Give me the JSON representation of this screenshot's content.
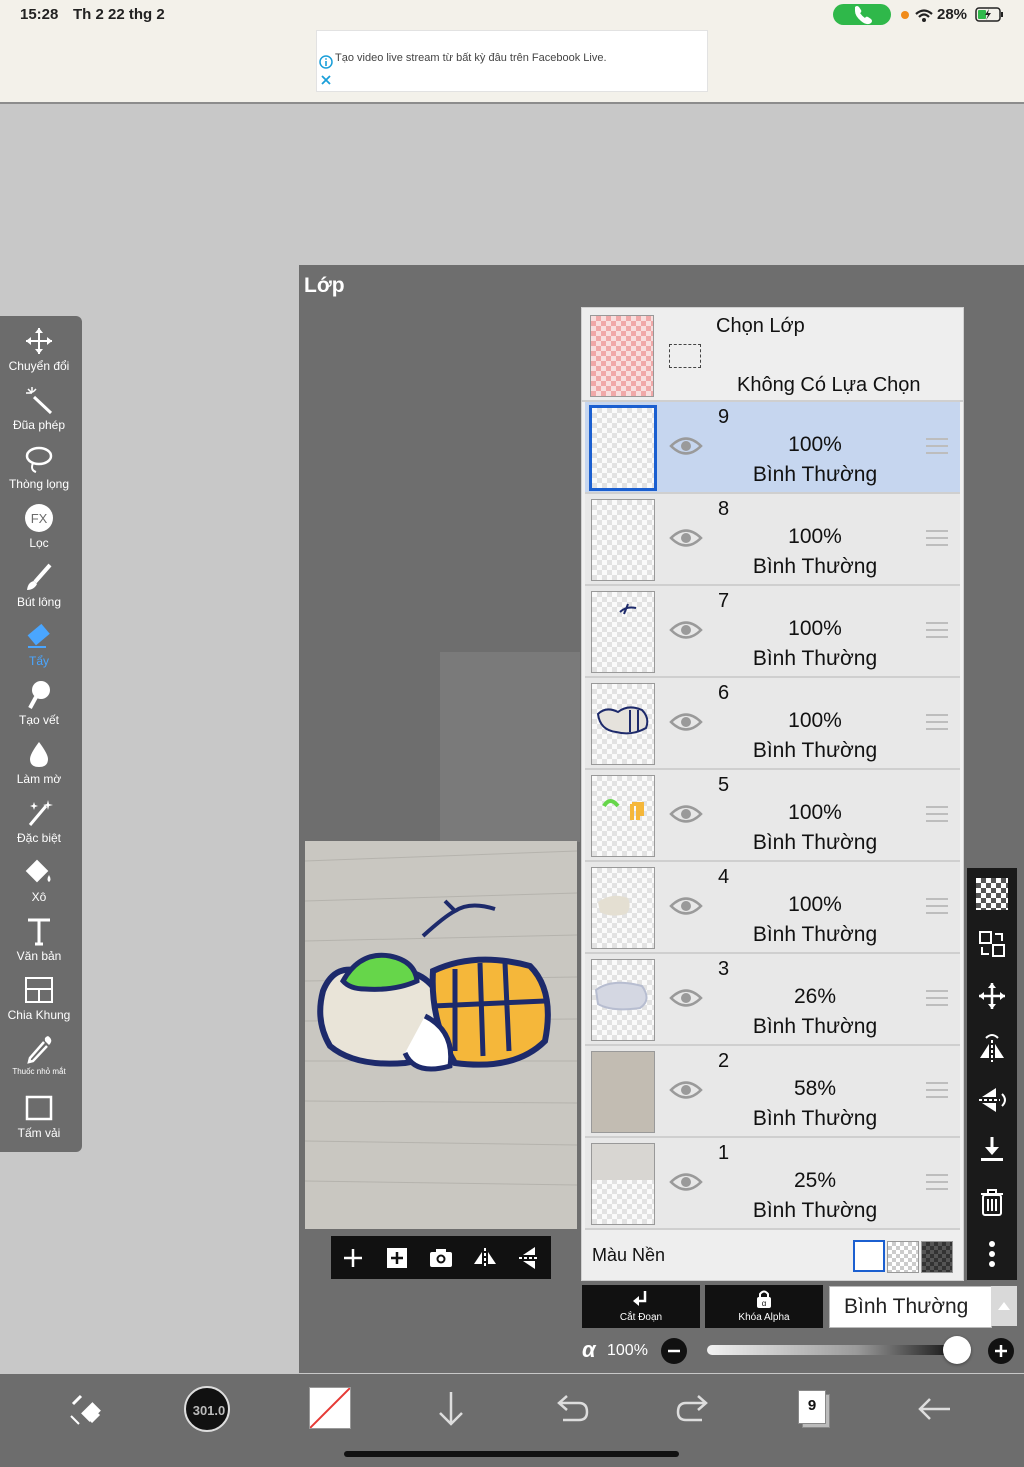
{
  "status_bar": {
    "time": "15:28",
    "date": "Th 2 22 thg 2",
    "battery": "28%"
  },
  "ad": {
    "text": "Tạo video live stream từ bất kỳ đâu trên Facebook Live."
  },
  "tools": [
    {
      "label": "Chuyển đổi",
      "icon": "move-icon"
    },
    {
      "label": "Đũa phép",
      "icon": "magic-wand-icon"
    },
    {
      "label": "Thòng lọng",
      "icon": "lasso-icon"
    },
    {
      "label": "Lọc",
      "icon": "fx-icon"
    },
    {
      "label": "Bút lông",
      "icon": "brush-icon"
    },
    {
      "label": "Tẩy",
      "icon": "eraser-icon",
      "active": true
    },
    {
      "label": "Tạo vết",
      "icon": "smudge-icon"
    },
    {
      "label": "Làm mờ",
      "icon": "blur-icon"
    },
    {
      "label": "Đặc biệt",
      "icon": "special-icon"
    },
    {
      "label": "Xô",
      "icon": "bucket-icon"
    },
    {
      "label": "Văn bản",
      "icon": "text-icon"
    },
    {
      "label": "Chia Khung",
      "icon": "frame-divider-icon"
    },
    {
      "label": "Thuốc nhỏ mắt",
      "icon": "eyedropper-icon"
    },
    {
      "label": "Tấm vải",
      "icon": "canvas-icon"
    }
  ],
  "dialog": {
    "title": "Lớp"
  },
  "selection_layer": {
    "title": "Chọn Lớp",
    "status": "Không Có Lựa Chọn"
  },
  "layers": [
    {
      "num": "9",
      "opacity": "100%",
      "mode": "Bình Thường",
      "selected": true
    },
    {
      "num": "8",
      "opacity": "100%",
      "mode": "Bình Thường"
    },
    {
      "num": "7",
      "opacity": "100%",
      "mode": "Bình Thường"
    },
    {
      "num": "6",
      "opacity": "100%",
      "mode": "Bình Thường"
    },
    {
      "num": "5",
      "opacity": "100%",
      "mode": "Bình Thường"
    },
    {
      "num": "4",
      "opacity": "100%",
      "mode": "Bình Thường"
    },
    {
      "num": "3",
      "opacity": "26%",
      "mode": "Bình Thường"
    },
    {
      "num": "2",
      "opacity": "58%",
      "mode": "Bình Thường"
    },
    {
      "num": "1",
      "opacity": "25%",
      "mode": "Bình Thường"
    }
  ],
  "background": {
    "label": "Màu Nền"
  },
  "bottom_controls": {
    "clip_label": "Cắt Đoạn",
    "alpha_lock_label": "Khóa Alpha",
    "blend_mode": "Bình Thường",
    "alpha_symbol": "α",
    "opacity": "100%",
    "opacity_fraction": 1.0
  },
  "bottom_bar": {
    "brush_size": "301.0",
    "layer_count": "9"
  },
  "colors": {
    "accent": "#1b5fd0",
    "selected_row": "#c6d6ef",
    "active_tool": "#4aa6ff",
    "call_green": "#2fb84a"
  }
}
